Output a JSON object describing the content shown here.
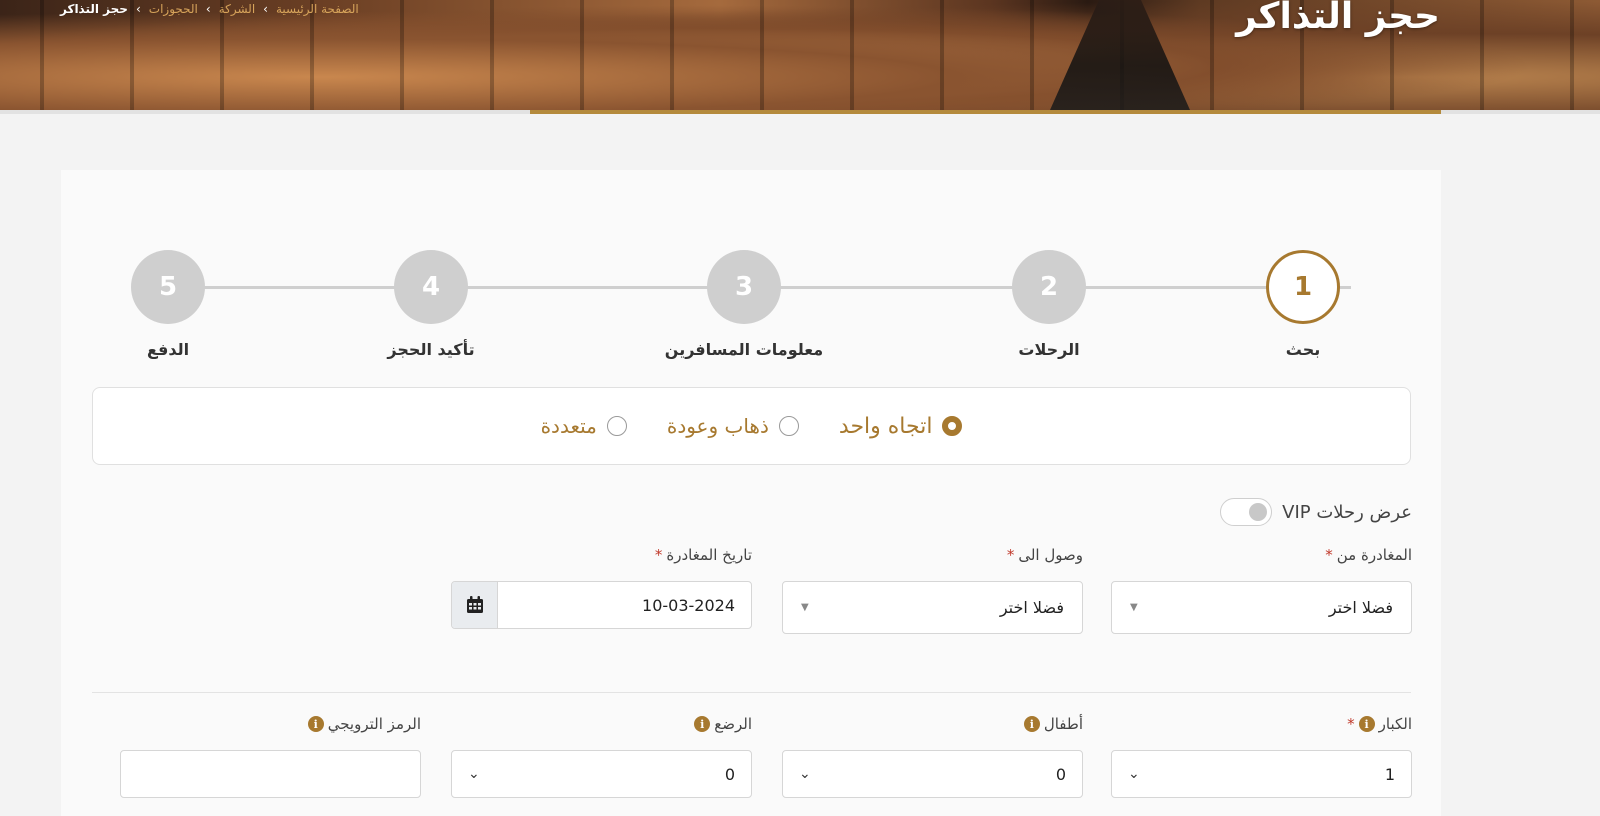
{
  "hero": {
    "title": "حجز التذاكر",
    "breadcrumb": [
      "الصفحة الرئيسية",
      "الشركة",
      "الحجوزات",
      "حجز التذاكر"
    ]
  },
  "steps": [
    {
      "number": "1",
      "label": "بحث",
      "active": true
    },
    {
      "number": "2",
      "label": "الرحلات",
      "active": false
    },
    {
      "number": "3",
      "label": "معلومات المسافرين",
      "active": false
    },
    {
      "number": "4",
      "label": "تأكيد الحجز",
      "active": false
    },
    {
      "number": "5",
      "label": "الدفع",
      "active": false
    }
  ],
  "trip_type": {
    "options": [
      "اتجاه واحد",
      "ذهاب وعودة",
      "متعددة"
    ],
    "selected": "اتجاه واحد"
  },
  "vip": {
    "label": "عرض رحلات VIP",
    "enabled": false
  },
  "route": {
    "from": {
      "label": "المغادرة من",
      "required_mark": "*",
      "value": "فضلا اختر"
    },
    "to": {
      "label": "وصول الى",
      "required_mark": "*",
      "value": "فضلا اختر"
    },
    "date": {
      "label": "تاريخ المغادرة",
      "required_mark": "*",
      "value": "10-03-2024"
    }
  },
  "passengers": {
    "adults": {
      "label": "الكبار",
      "required_mark": "*",
      "value": "1"
    },
    "children": {
      "label": "أطفال",
      "value": "0"
    },
    "infants": {
      "label": "الرضع",
      "value": "0"
    },
    "promo": {
      "label": "الرمز الترويجي",
      "value": ""
    }
  },
  "colors": {
    "accent": "#a7792f",
    "gold_bar": "#b48a3c",
    "required": "#c0392b"
  }
}
